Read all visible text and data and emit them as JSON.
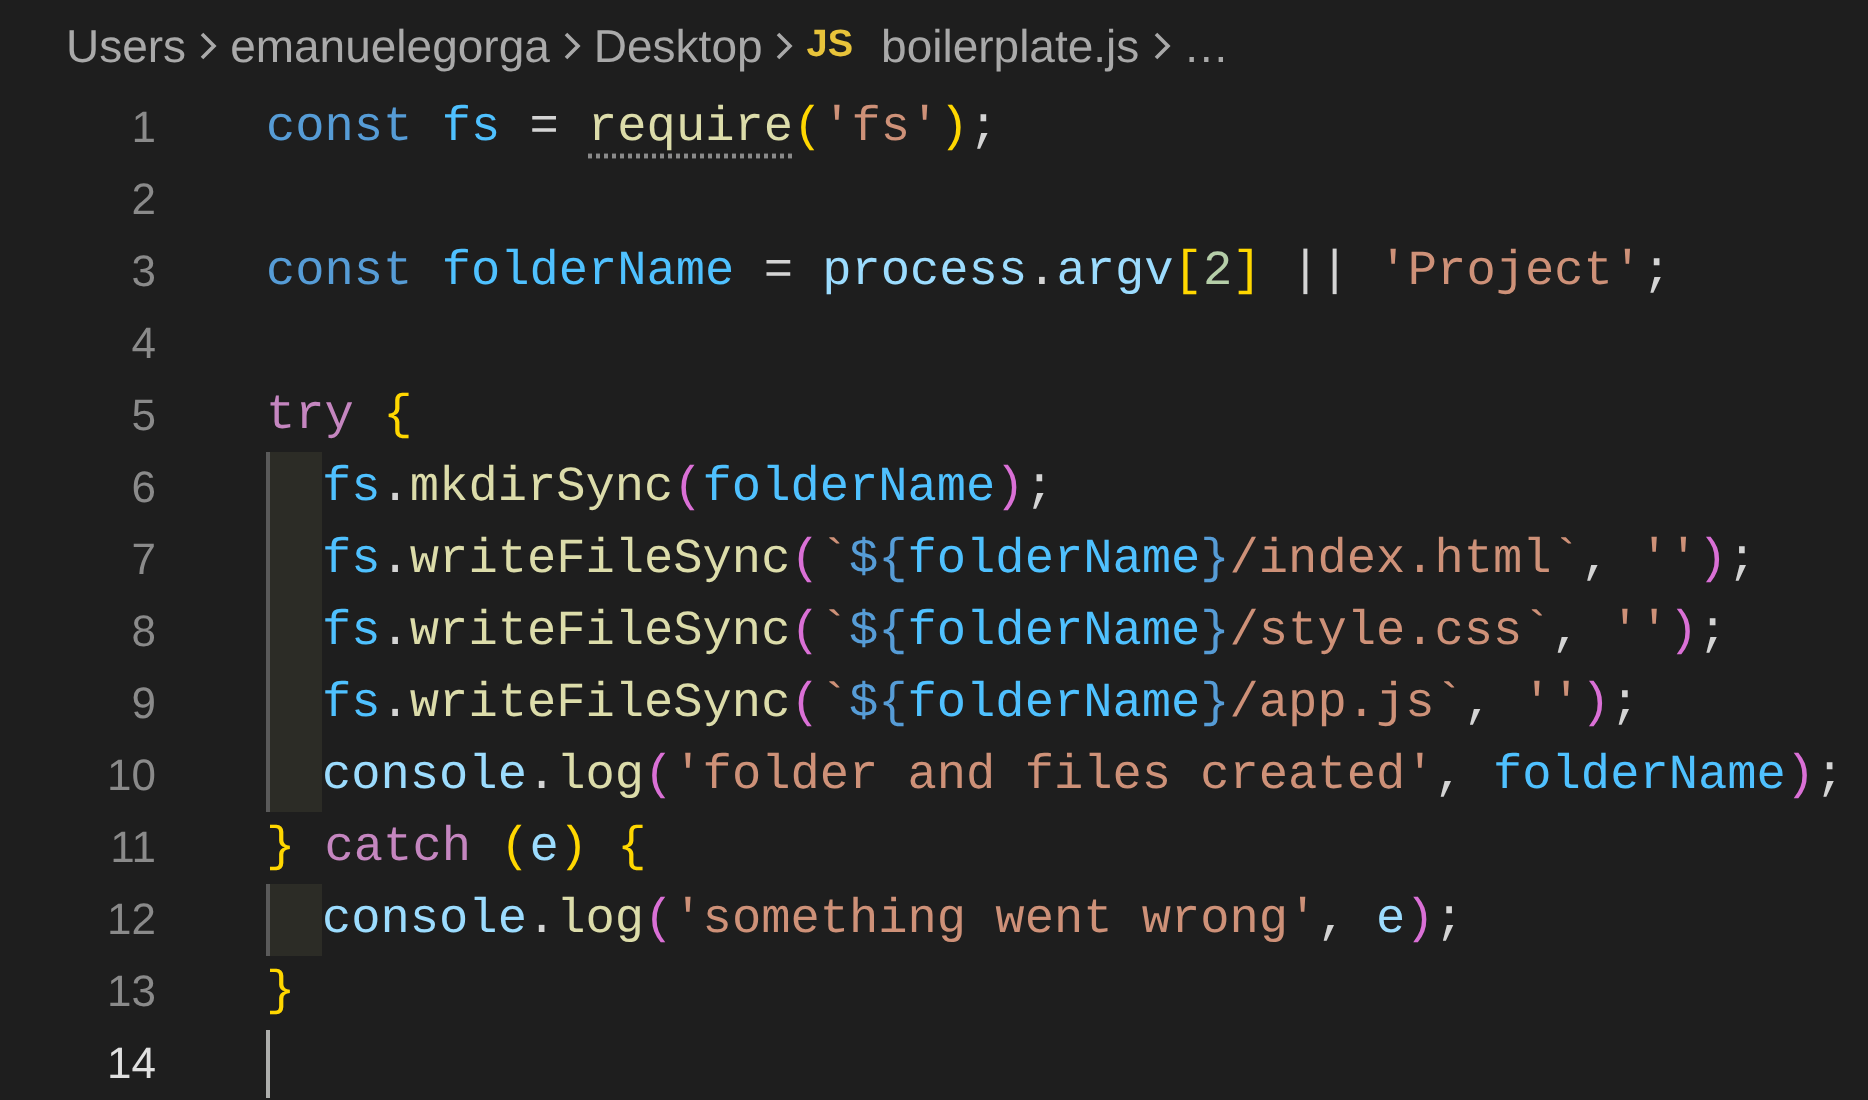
{
  "breadcrumb": {
    "segments": [
      "Users",
      "emanuelegorga",
      "Desktop"
    ],
    "file_badge": "JS",
    "file_name": "boilerplate.js",
    "more": "…"
  },
  "lines": [
    {
      "number": "1",
      "indent": false,
      "active": false,
      "tokens": [
        {
          "t": "const ",
          "kind": "keyword"
        },
        {
          "t": "fs",
          "kind": "constant"
        },
        {
          "t": " = ",
          "kind": "plain"
        },
        {
          "t": "require",
          "kind": "hint-function"
        },
        {
          "t": "(",
          "kind": "paren1"
        },
        {
          "t": "'fs'",
          "kind": "string"
        },
        {
          "t": ")",
          "kind": "paren1"
        },
        {
          "t": ";",
          "kind": "plain"
        }
      ]
    },
    {
      "number": "2",
      "indent": false,
      "active": false
    },
    {
      "number": "3",
      "indent": false,
      "active": false,
      "tokens": [
        {
          "t": "const ",
          "kind": "keyword"
        },
        {
          "t": "folderName",
          "kind": "constant"
        },
        {
          "t": " = ",
          "kind": "plain"
        },
        {
          "t": "process",
          "kind": "variable"
        },
        {
          "t": ".",
          "kind": "plain"
        },
        {
          "t": "argv",
          "kind": "variable"
        },
        {
          "t": "[",
          "kind": "paren1"
        },
        {
          "t": "2",
          "kind": "number"
        },
        {
          "t": "]",
          "kind": "paren1"
        },
        {
          "t": " || ",
          "kind": "plain"
        },
        {
          "t": "'Project'",
          "kind": "string"
        },
        {
          "t": ";",
          "kind": "plain"
        }
      ]
    },
    {
      "number": "4",
      "indent": false,
      "active": false
    },
    {
      "number": "5",
      "indent": false,
      "active": false,
      "tokens": [
        {
          "t": "try ",
          "kind": "control"
        },
        {
          "t": "{",
          "kind": "paren1"
        }
      ]
    },
    {
      "number": "6",
      "indent": true,
      "active": false,
      "tokens": [
        {
          "t": "fs",
          "kind": "constant"
        },
        {
          "t": ".",
          "kind": "plain"
        },
        {
          "t": "mkdirSync",
          "kind": "function"
        },
        {
          "t": "(",
          "kind": "paren2"
        },
        {
          "t": "folderName",
          "kind": "constant"
        },
        {
          "t": ")",
          "kind": "paren2"
        },
        {
          "t": ";",
          "kind": "plain"
        }
      ]
    },
    {
      "number": "7",
      "indent": true,
      "active": false,
      "tokens": [
        {
          "t": "fs",
          "kind": "constant"
        },
        {
          "t": ".",
          "kind": "plain"
        },
        {
          "t": "writeFileSync",
          "kind": "function"
        },
        {
          "t": "(",
          "kind": "paren2"
        },
        {
          "t": "`",
          "kind": "string"
        },
        {
          "t": "${",
          "kind": "keyword"
        },
        {
          "t": "folderName",
          "kind": "constant"
        },
        {
          "t": "}",
          "kind": "keyword"
        },
        {
          "t": "/index.html`",
          "kind": "string"
        },
        {
          "t": ", ",
          "kind": "plain"
        },
        {
          "t": "''",
          "kind": "string"
        },
        {
          "t": ")",
          "kind": "paren2"
        },
        {
          "t": ";",
          "kind": "plain"
        }
      ]
    },
    {
      "number": "8",
      "indent": true,
      "active": false,
      "tokens": [
        {
          "t": "fs",
          "kind": "constant"
        },
        {
          "t": ".",
          "kind": "plain"
        },
        {
          "t": "writeFileSync",
          "kind": "function"
        },
        {
          "t": "(",
          "kind": "paren2"
        },
        {
          "t": "`",
          "kind": "string"
        },
        {
          "t": "${",
          "kind": "keyword"
        },
        {
          "t": "folderName",
          "kind": "constant"
        },
        {
          "t": "}",
          "kind": "keyword"
        },
        {
          "t": "/style.css`",
          "kind": "string"
        },
        {
          "t": ", ",
          "kind": "plain"
        },
        {
          "t": "''",
          "kind": "string"
        },
        {
          "t": ")",
          "kind": "paren2"
        },
        {
          "t": ";",
          "kind": "plain"
        }
      ]
    },
    {
      "number": "9",
      "indent": true,
      "active": false,
      "tokens": [
        {
          "t": "fs",
          "kind": "constant"
        },
        {
          "t": ".",
          "kind": "plain"
        },
        {
          "t": "writeFileSync",
          "kind": "function"
        },
        {
          "t": "(",
          "kind": "paren2"
        },
        {
          "t": "`",
          "kind": "string"
        },
        {
          "t": "${",
          "kind": "keyword"
        },
        {
          "t": "folderName",
          "kind": "constant"
        },
        {
          "t": "}",
          "kind": "keyword"
        },
        {
          "t": "/app.js`",
          "kind": "string"
        },
        {
          "t": ", ",
          "kind": "plain"
        },
        {
          "t": "''",
          "kind": "string"
        },
        {
          "t": ")",
          "kind": "paren2"
        },
        {
          "t": ";",
          "kind": "plain"
        }
      ]
    },
    {
      "number": "10",
      "indent": true,
      "active": false,
      "tokens": [
        {
          "t": "console",
          "kind": "variable"
        },
        {
          "t": ".",
          "kind": "plain"
        },
        {
          "t": "log",
          "kind": "function"
        },
        {
          "t": "(",
          "kind": "paren2"
        },
        {
          "t": "'folder and files created'",
          "kind": "string"
        },
        {
          "t": ", ",
          "kind": "plain"
        },
        {
          "t": "folderName",
          "kind": "constant"
        },
        {
          "t": ")",
          "kind": "paren2"
        },
        {
          "t": ";",
          "kind": "plain"
        }
      ]
    },
    {
      "number": "11",
      "indent": false,
      "active": false,
      "tokens": [
        {
          "t": "}",
          "kind": "paren1"
        },
        {
          "t": " catch ",
          "kind": "control"
        },
        {
          "t": "(",
          "kind": "paren1"
        },
        {
          "t": "e",
          "kind": "variable"
        },
        {
          "t": ") {",
          "kind": "paren1"
        }
      ]
    },
    {
      "number": "12",
      "indent": true,
      "active": false,
      "tokens": [
        {
          "t": "console",
          "kind": "variable"
        },
        {
          "t": ".",
          "kind": "plain"
        },
        {
          "t": "log",
          "kind": "function"
        },
        {
          "t": "(",
          "kind": "paren2"
        },
        {
          "t": "'something went wrong'",
          "kind": "string"
        },
        {
          "t": ", ",
          "kind": "plain"
        },
        {
          "t": "e",
          "kind": "variable"
        },
        {
          "t": ")",
          "kind": "paren2"
        },
        {
          "t": ";",
          "kind": "plain"
        }
      ]
    },
    {
      "number": "13",
      "indent": false,
      "active": false,
      "tokens": [
        {
          "t": "}",
          "kind": "paren1"
        }
      ]
    },
    {
      "number": "14",
      "indent": false,
      "active": true
    }
  ]
}
